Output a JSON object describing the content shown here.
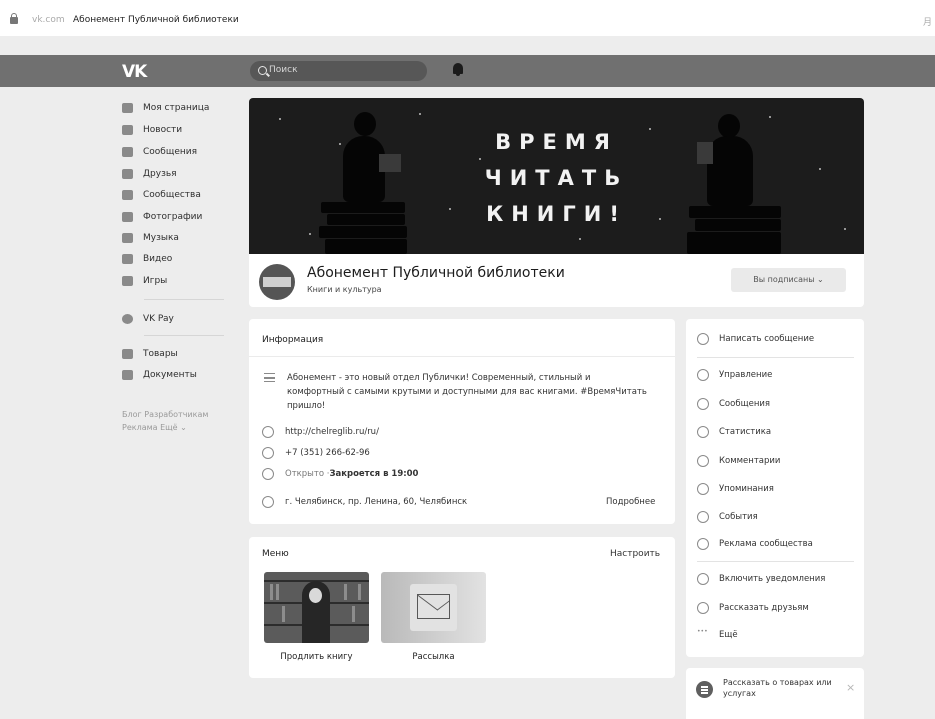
{
  "browser": {
    "domain": "vk.com",
    "page_title": "Абонемент Публичной библиотеки",
    "corner_text": "月"
  },
  "header": {
    "logo": "VK",
    "search_placeholder": "Поиск"
  },
  "sidebar": {
    "items": [
      {
        "label": "Моя страница",
        "icon": "home-icon"
      },
      {
        "label": "Новости",
        "icon": "news-icon"
      },
      {
        "label": "Сообщения",
        "icon": "messages-icon"
      },
      {
        "label": "Друзья",
        "icon": "friends-icon"
      },
      {
        "label": "Сообщества",
        "icon": "communities-icon"
      },
      {
        "label": "Фотографии",
        "icon": "photos-icon"
      },
      {
        "label": "Музыка",
        "icon": "music-icon"
      },
      {
        "label": "Видео",
        "icon": "video-icon"
      },
      {
        "label": "Игры",
        "icon": "games-icon"
      }
    ],
    "vkpay": "VK Pay",
    "extra": [
      {
        "label": "Товары",
        "icon": "goods-icon"
      },
      {
        "label": "Документы",
        "icon": "documents-icon"
      }
    ],
    "footer_line1": "Блог   Разработчикам",
    "footer_line2": "Реклама   Ещё ⌄"
  },
  "cover": {
    "lines": [
      "ВРЕМЯ",
      "ЧИТАТЬ",
      "КНИГИ!"
    ]
  },
  "profile": {
    "name": "Абонемент Публичной библиотеки",
    "category": "Книги и культура",
    "subscribe_button": "Вы подписаны ⌄"
  },
  "info": {
    "title": "Информация",
    "description": "Абонемент - это новый отдел Публички! Современный, стильный и комфортный с самыми крутыми и доступными для вас книгами. #ВремяЧитать пришло!",
    "website": "http://chelreglib.ru/ru/",
    "phone": "+7 (351) 266-62-96",
    "status_open": "Открыто · ",
    "status_close": "Закроется в 19:00",
    "address": "г. Челябинск, пр. Ленина, 60, Челябинск",
    "more": "Подробнее"
  },
  "menu": {
    "title": "Меню",
    "configure": "Настроить",
    "items": [
      {
        "label": "Продлить книгу"
      },
      {
        "label": "Рассылка"
      }
    ]
  },
  "actions": {
    "write": "Написать сообщение",
    "group1": [
      {
        "label": "Управление",
        "icon": "gear-icon"
      },
      {
        "label": "Сообщения",
        "icon": "chat-icon"
      },
      {
        "label": "Статистика",
        "icon": "stats-icon"
      },
      {
        "label": "Комментарии",
        "icon": "comment-icon"
      },
      {
        "label": "Упоминания",
        "icon": "at-icon"
      },
      {
        "label": "События",
        "icon": "events-icon"
      },
      {
        "label": "Реклама сообщества",
        "icon": "megaphone-icon"
      }
    ],
    "group2": [
      {
        "label": "Включить уведомления",
        "icon": "bell-icon"
      },
      {
        "label": "Рассказать друзьям",
        "icon": "share-icon"
      },
      {
        "label": "Ещё",
        "icon": "more-icon"
      }
    ]
  },
  "notice": {
    "text": "Рассказать о товарах или услугах",
    "close": "×"
  }
}
